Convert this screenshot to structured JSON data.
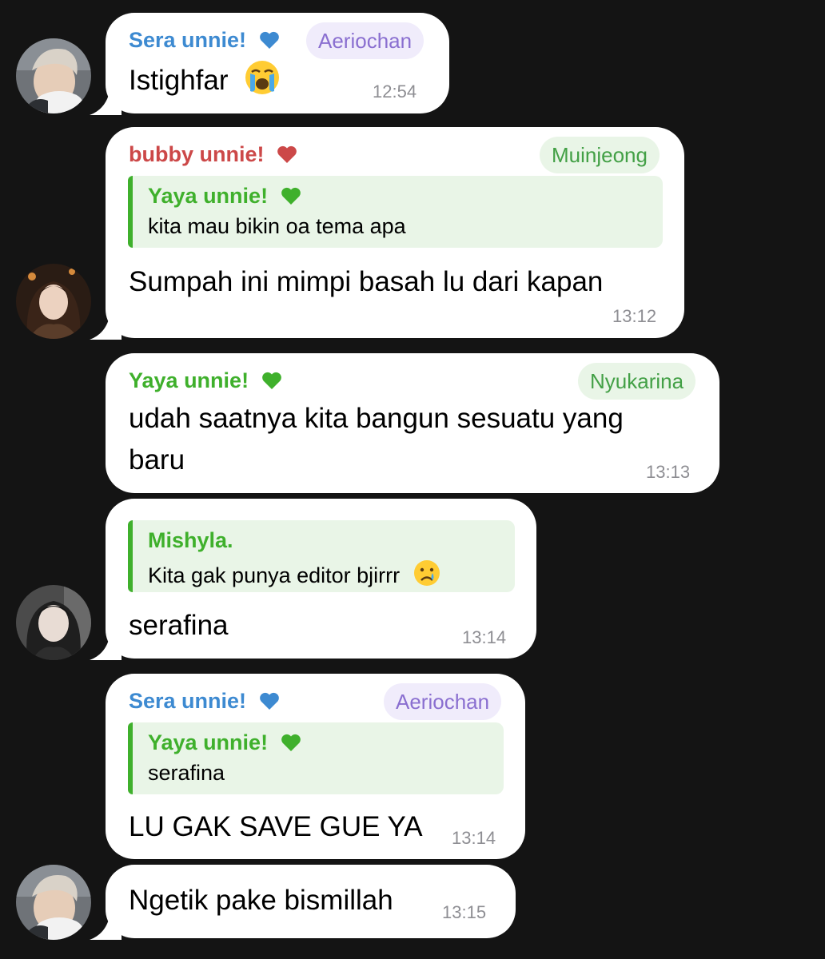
{
  "colors": {
    "background": "#141414",
    "bubble": "#ffffff",
    "name_blue": "#3d8ad1",
    "name_red": "#cc4848",
    "name_green": "#3fb02c",
    "tag_purple_text": "#8a6fd0",
    "tag_green_text": "#43a046",
    "timestamp": "#8e8e93"
  },
  "messages": [
    {
      "sender": "Sera unnie!",
      "heart": "blue-heart-icon",
      "tag": "Aeriochan",
      "text": "Istighfar",
      "emoji": "loudly-crying-face-icon",
      "time": "12:54"
    },
    {
      "sender": "bubby unnie!",
      "heart": "red-heart-icon",
      "tag": "Muinjeong",
      "reply": {
        "name": "Yaya unnie!",
        "heart": "green-heart-icon",
        "text": "kita mau bikin oa tema apa"
      },
      "text": "Sumpah ini mimpi basah lu dari kapan",
      "time": "13:12"
    },
    {
      "sender": "Yaya unnie!",
      "heart": "green-heart-icon",
      "tag": "Nyukarina",
      "text_line1": "udah saatnya kita bangun sesuatu yang",
      "text_line2": "baru",
      "time": "13:13"
    },
    {
      "reply": {
        "name": "Mishyla.",
        "text": "Kita gak punya editor bjirrr",
        "emoji": "crying-face-icon"
      },
      "text": "serafina",
      "time": "13:14"
    },
    {
      "sender": "Sera unnie!",
      "heart": "blue-heart-icon",
      "tag": "Aeriochan",
      "reply": {
        "name": "Yaya unnie!",
        "heart": "green-heart-icon",
        "text": "serafina"
      },
      "text": "LU GAK SAVE GUE YA",
      "time": "13:14"
    },
    {
      "text": "Ngetik pake bismillah",
      "time": "13:15"
    }
  ]
}
